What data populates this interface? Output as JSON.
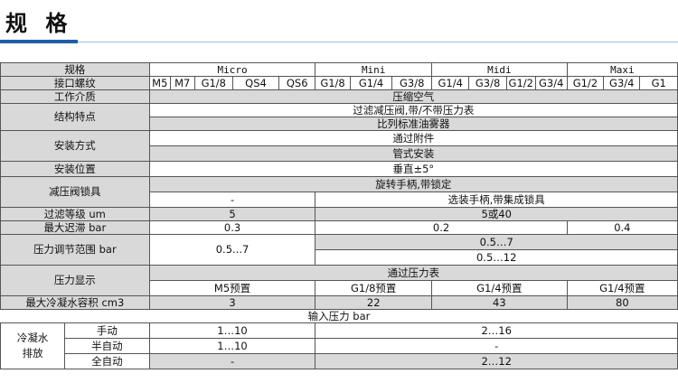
{
  "header": {
    "title": "规 格"
  },
  "table": {
    "rows": {
      "spec": {
        "label": "规格",
        "groups": [
          "Micro",
          "Mini",
          "Midi",
          "Maxi"
        ]
      },
      "port": {
        "label": "接口螺纹",
        "values": [
          "M5",
          "M7",
          "G1/8",
          "QS4",
          "QS6",
          "G1/8",
          "G1/4",
          "G3/8",
          "G1/4",
          "G3/8",
          "G1/2",
          "G3/4",
          "G1/2",
          "G3/4",
          "G1"
        ]
      },
      "medium": {
        "label": "工作介质",
        "value": "压缩空气"
      },
      "structure": {
        "label": "结构特点",
        "value1": "过滤减压阀,带/不带压力表",
        "value2": "比列标准油雾器"
      },
      "mounting": {
        "label": "安装方式",
        "value1": "通过附件",
        "value2": "管式安装"
      },
      "position": {
        "label": "安装位置",
        "value": "垂直±5°"
      },
      "lock": {
        "label": "减压阀锁具",
        "value1": "旋转手柄,带锁定",
        "value2_micro": "-",
        "value2_rest": "选装手柄,带集成锁具"
      },
      "filter": {
        "label": "过滤等级 um",
        "micro": "5",
        "rest": "5或40"
      },
      "hysteresis": {
        "label": "最大迟滞 bar",
        "micro": "0.3",
        "mid": "0.2",
        "maxi": "0.4"
      },
      "pressure_range": {
        "label": "压力调节范围 bar",
        "micro": "0.5...7",
        "rest1": "0.5…7",
        "rest2": "0.5…12"
      },
      "gauge": {
        "label": "压力显示",
        "value": "通过压力表",
        "micro": "M5预置",
        "mini": "G1/8预置",
        "midi": "G1/4预置",
        "maxi": "G1/4预置"
      },
      "condensate": {
        "label": "最大冷凝水容积 cm3",
        "micro": "3",
        "mini": "22",
        "midi": "43",
        "maxi": "80"
      },
      "input_pressure": {
        "label": "输入压力 bar"
      },
      "drain": {
        "label_line1": "冷凝水",
        "label_line2": "排放",
        "manual": {
          "label": "手动",
          "micro": "1…10",
          "rest": "2…16"
        },
        "semi": {
          "label": "半自动",
          "micro": "1…10",
          "rest": "-"
        },
        "auto": {
          "label": "全自动",
          "micro": "-",
          "rest": "2…12"
        }
      }
    }
  }
}
